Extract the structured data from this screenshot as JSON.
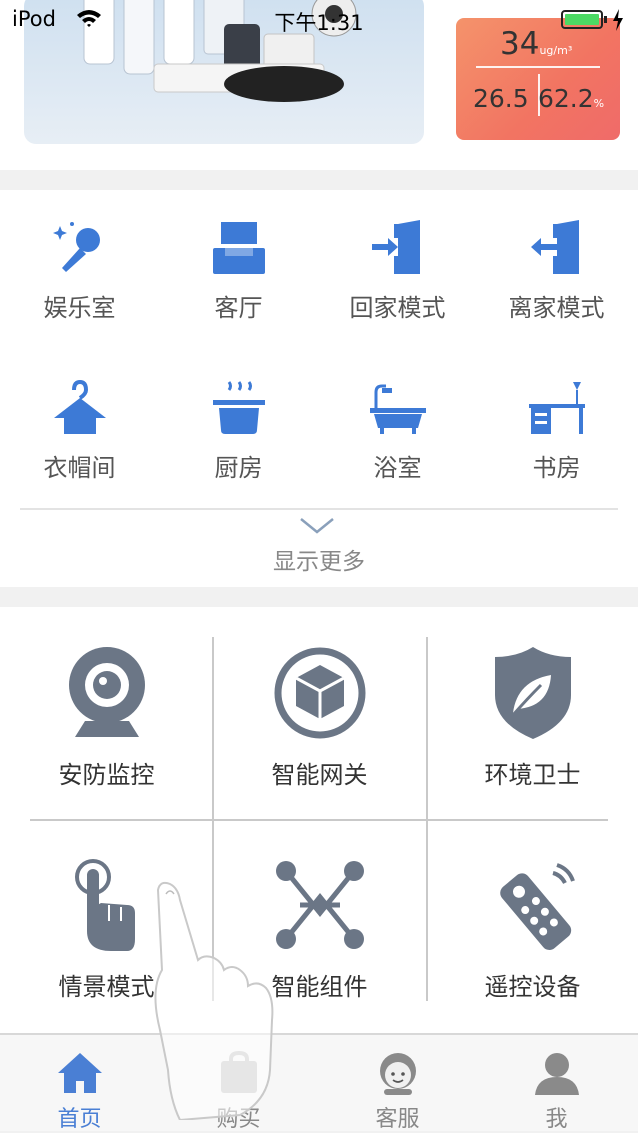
{
  "status": {
    "carrier": "iPod",
    "time": "下午1:31"
  },
  "environment": {
    "pm": "34",
    "pm_unit": "ug/m³",
    "temperature": "26.5",
    "humidity": "62.2",
    "humidity_unit": "%"
  },
  "rooms": [
    {
      "label": "娱乐室",
      "icon": "microphone-icon"
    },
    {
      "label": "客厅",
      "icon": "sofa-icon"
    },
    {
      "label": "回家模式",
      "icon": "door-enter-icon"
    },
    {
      "label": "离家模式",
      "icon": "door-exit-icon"
    },
    {
      "label": "衣帽间",
      "icon": "hanger-icon"
    },
    {
      "label": "厨房",
      "icon": "pot-icon"
    },
    {
      "label": "浴室",
      "icon": "bathtub-icon"
    },
    {
      "label": "书房",
      "icon": "desk-icon"
    }
  ],
  "show_more": "显示更多",
  "features": [
    {
      "label": "安防监控",
      "icon": "webcam-icon"
    },
    {
      "label": "智能网关",
      "icon": "cube-icon"
    },
    {
      "label": "环境卫士",
      "icon": "leaf-shield-icon"
    },
    {
      "label": "情景模式",
      "icon": "tap-hand-icon"
    },
    {
      "label": "智能组件",
      "icon": "network-icon"
    },
    {
      "label": "遥控设备",
      "icon": "remote-control-icon"
    }
  ],
  "tabs": [
    {
      "label": "首页",
      "icon": "home-icon",
      "active": true
    },
    {
      "label": "购买",
      "icon": "shop-icon",
      "active": false
    },
    {
      "label": "客服",
      "icon": "support-icon",
      "active": false
    },
    {
      "label": "我",
      "icon": "user-icon",
      "active": false
    }
  ],
  "colors": {
    "accent": "#4a7fd4",
    "room_icon": "#3d7ad6",
    "feature_icon": "#6b7686",
    "env_card": "#f27462"
  }
}
